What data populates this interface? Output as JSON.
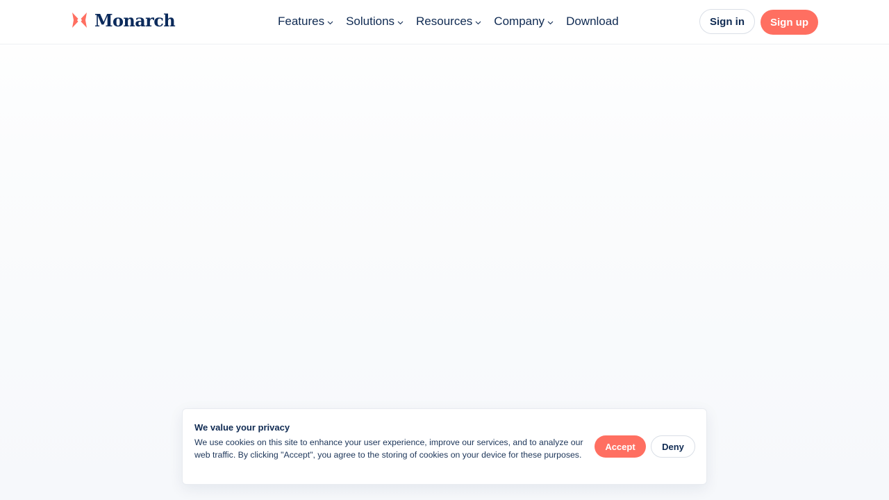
{
  "brand": {
    "name": "Monarch",
    "accent_color": "#ff6f61",
    "text_color": "#0b2a5b",
    "logo_icon": "butterfly-icon"
  },
  "nav": {
    "items": [
      {
        "label": "Features",
        "has_dropdown": true
      },
      {
        "label": "Solutions",
        "has_dropdown": true
      },
      {
        "label": "Resources",
        "has_dropdown": true
      },
      {
        "label": "Company",
        "has_dropdown": true
      },
      {
        "label": "Download",
        "has_dropdown": false
      }
    ],
    "dropdown_icon": "chevron-down-icon"
  },
  "auth": {
    "sign_in_label": "Sign in",
    "sign_up_label": "Sign up"
  },
  "cookie_banner": {
    "title": "We value your privacy",
    "body": "We use cookies on this site to enhance your user experience, improve our services, and to analyze our web traffic. By clicking \"Accept\", you agree to the storing of cookies on your device for these purposes.",
    "accept_label": "Accept",
    "deny_label": "Deny"
  }
}
